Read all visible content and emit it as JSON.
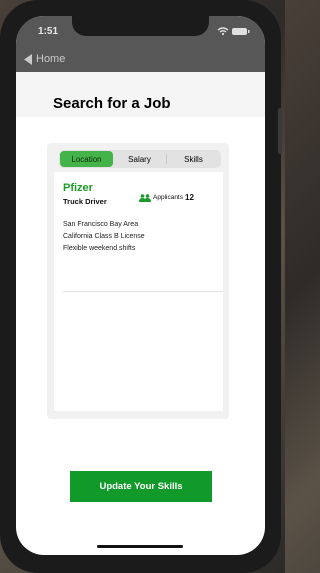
{
  "status_bar": {
    "time": "1:51"
  },
  "nav": {
    "back_label": "Home"
  },
  "page": {
    "title": "Search for a Job"
  },
  "segments": [
    {
      "label": "Location",
      "active": true
    },
    {
      "label": "Salary",
      "active": false
    },
    {
      "label": "Skills",
      "active": false
    }
  ],
  "job_card": {
    "company": "Pfizer",
    "role": "Truck Driver",
    "applicants_label": "Applicants",
    "applicants_count": "12",
    "details": [
      "San Francisco Bay Area",
      "California Class B License",
      "Flexible weekend shifts"
    ]
  },
  "cta": {
    "label": "Update Your Skills"
  },
  "colors": {
    "accent": "#119a2a",
    "segment_active": "#44b34a",
    "company_text": "#1a9b2a"
  },
  "icons": [
    "back-chevron-icon",
    "wifi-icon",
    "battery-icon",
    "people-icon"
  ]
}
